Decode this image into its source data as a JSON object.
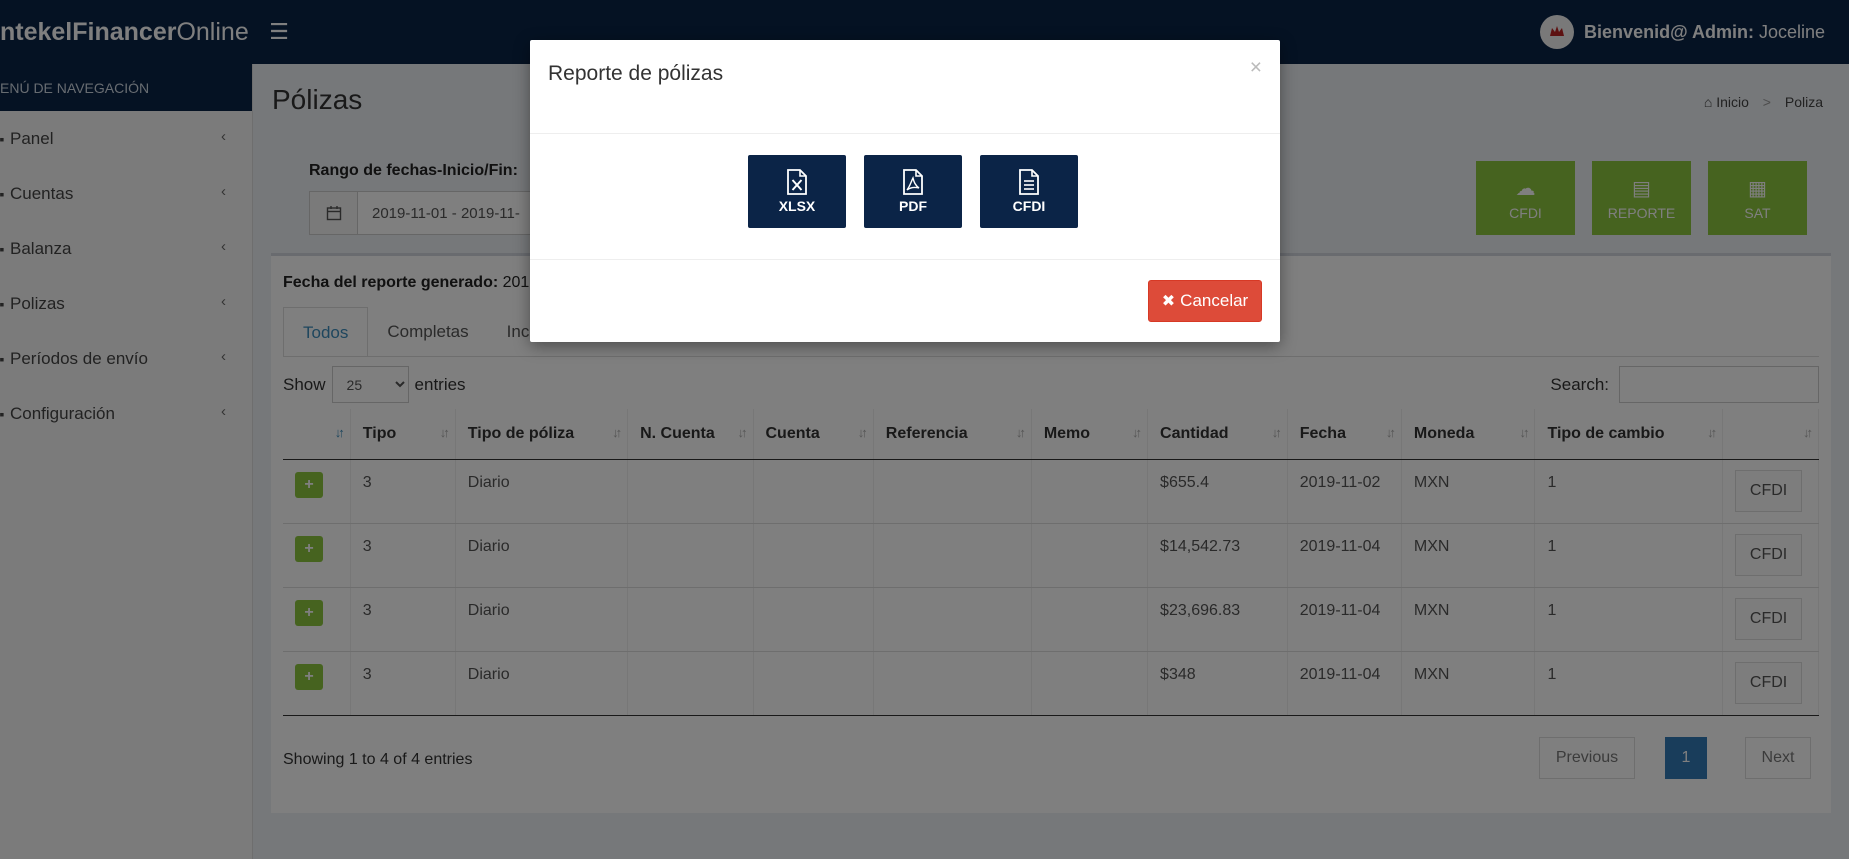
{
  "header": {
    "logo_bold": "ntekelFinancer",
    "logo_light": "Online",
    "menu_icon": "☰",
    "welcome_bold": "Bienvenid@ Admin:",
    "welcome_user": " Joceline"
  },
  "sidebar": {
    "header": "ENÚ DE NAVEGACIÓN",
    "items": [
      {
        "label": "Panel"
      },
      {
        "label": "Cuentas"
      },
      {
        "label": "Balanza"
      },
      {
        "label": "Polizas"
      },
      {
        "label": "Períodos de envío"
      },
      {
        "label": "Configuración"
      }
    ]
  },
  "page": {
    "title": "Pólizas",
    "breadcrumb_home": "Inicio",
    "breadcrumb_sep": ">",
    "breadcrumb_current": "Poliza"
  },
  "filters": {
    "date_label": "Rango de fechas-Inicio/Fin:",
    "date_value": "2019-11-01 - 2019-11-"
  },
  "actions": {
    "cfdi": "CFDI",
    "reporte": "REPORTE",
    "sat": "SAT"
  },
  "report": {
    "date_label": "Fecha del reporte generado:",
    "date_value": " 201"
  },
  "tabs": [
    "Todos",
    "Completas",
    "Inc"
  ],
  "table_controls": {
    "show_label": "Show",
    "entries_value": "25",
    "entries_label": "entries",
    "search_label": "Search:"
  },
  "table": {
    "columns": [
      "",
      "Tipo",
      "Tipo de póliza",
      "N. Cuenta",
      "Cuenta",
      "Referencia",
      "Memo",
      "Cantidad",
      "Fecha",
      "Moneda",
      "Tipo de cambio",
      ""
    ],
    "rows": [
      {
        "tipo": "3",
        "tipo_poliza": "Diario",
        "cantidad": "$655.4",
        "fecha": "2019-11-02",
        "moneda": "MXN",
        "cambio": "1",
        "btn": "CFDI"
      },
      {
        "tipo": "3",
        "tipo_poliza": "Diario",
        "cantidad": "$14,542.73",
        "fecha": "2019-11-04",
        "moneda": "MXN",
        "cambio": "1",
        "btn": "CFDI"
      },
      {
        "tipo": "3",
        "tipo_poliza": "Diario",
        "cantidad": "$23,696.83",
        "fecha": "2019-11-04",
        "moneda": "MXN",
        "cambio": "1",
        "btn": "CFDI"
      },
      {
        "tipo": "3",
        "tipo_poliza": "Diario",
        "cantidad": "$348",
        "fecha": "2019-11-04",
        "moneda": "MXN",
        "cambio": "1",
        "btn": "CFDI"
      }
    ],
    "showing": "Showing 1 to 4 of 4 entries",
    "prev": "Previous",
    "page": "1",
    "next": "Next"
  },
  "modal": {
    "title": "Reporte de pólizas",
    "close": "×",
    "xlsx": "XLSX",
    "pdf": "PDF",
    "cfdi": "CFDI",
    "cancel": "Cancelar"
  },
  "colors": {
    "navy": "#0b2447",
    "green": "#8dc63f",
    "danger": "#dd4b39",
    "primary": "#337ab7"
  }
}
